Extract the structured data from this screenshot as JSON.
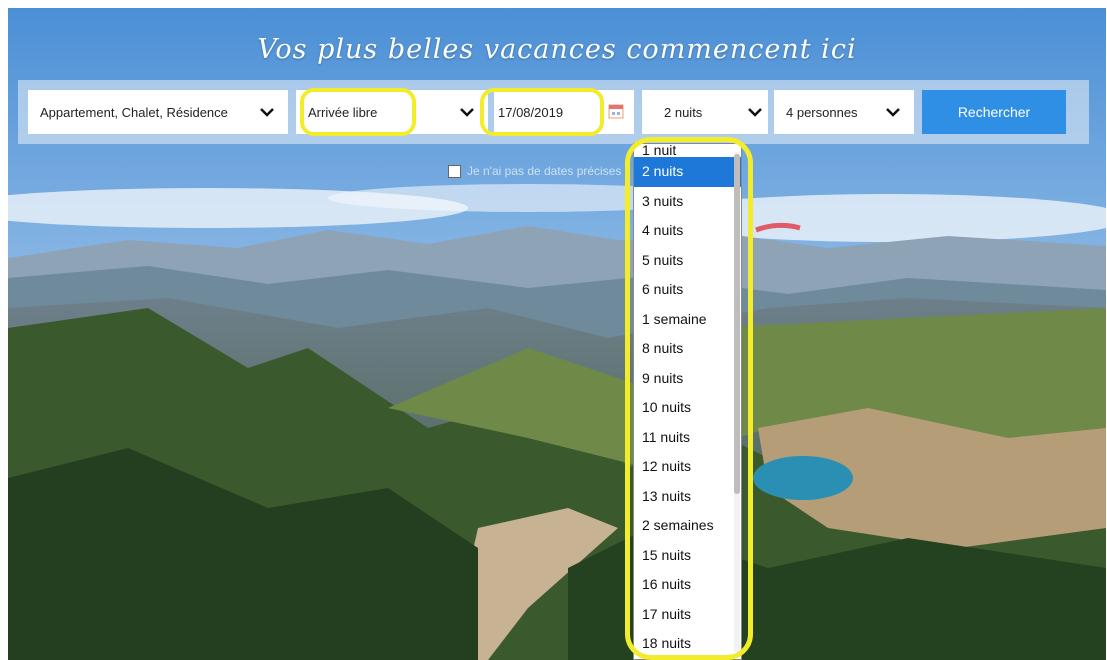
{
  "hero": {
    "title": "Vos plus belles vacances commencent ici"
  },
  "search": {
    "type_select": "Appartement, Chalet, Résidence",
    "arrival_select": "Arrivée libre",
    "date_value": "17/08/2019",
    "nights_select": "2 nuits",
    "persons_select": "4 personnes",
    "search_button": "Rechercher",
    "no_dates_label": "Je n'ai pas de dates précises"
  },
  "dropdown": {
    "selected": "2 nuits",
    "options": [
      "1 nuit",
      "2 nuits",
      "3 nuits",
      "4 nuits",
      "5 nuits",
      "6 nuits",
      "1 semaine",
      "8 nuits",
      "9 nuits",
      "10 nuits",
      "11 nuits",
      "12 nuits",
      "13 nuits",
      "2 semaines",
      "15 nuits",
      "16 nuits",
      "17 nuits",
      "18 nuits"
    ]
  },
  "colors": {
    "accent": "#2f8fe4",
    "selected_option": "#1e78d7",
    "highlight": "#f3ec2a"
  },
  "icons": {
    "chevron": "chevron-down-icon",
    "calendar": "calendar-icon"
  }
}
